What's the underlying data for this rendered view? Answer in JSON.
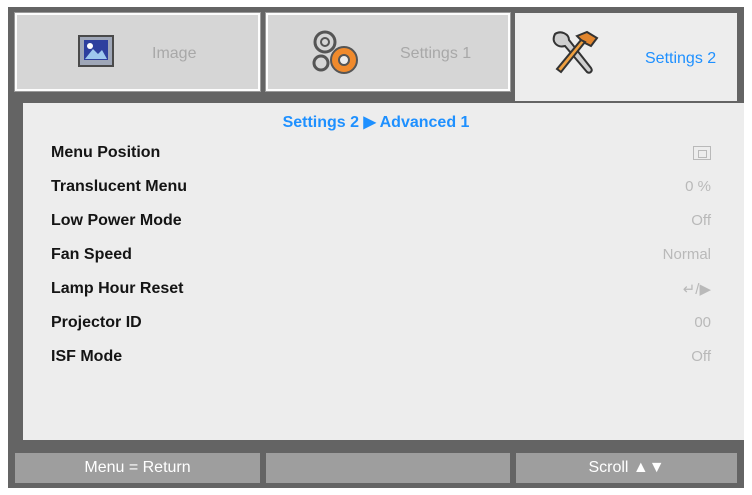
{
  "tabs": [
    {
      "label": "Image",
      "icon": "image-icon"
    },
    {
      "label": "Settings 1",
      "icon": "gears-icon"
    },
    {
      "label": "Settings 2",
      "icon": "tools-icon"
    }
  ],
  "breadcrumb": "Settings 2 ▶ Advanced 1",
  "rows": [
    {
      "label": "Menu Position",
      "value": "",
      "value_icon": "menu-position-icon"
    },
    {
      "label": "Translucent Menu",
      "value": "0 %"
    },
    {
      "label": "Low Power Mode",
      "value": "Off"
    },
    {
      "label": "Fan Speed",
      "value": "Normal"
    },
    {
      "label": "Lamp Hour Reset",
      "value": "↵/▶"
    },
    {
      "label": "Projector ID",
      "value": "00"
    },
    {
      "label": "ISF Mode",
      "value": "Off"
    }
  ],
  "footer": {
    "left": "Menu = Return",
    "middle": "",
    "right": "Scroll ▲▼"
  },
  "colors": {
    "accent": "#1e90ff",
    "frame": "#646464",
    "panel": "#ededed"
  }
}
